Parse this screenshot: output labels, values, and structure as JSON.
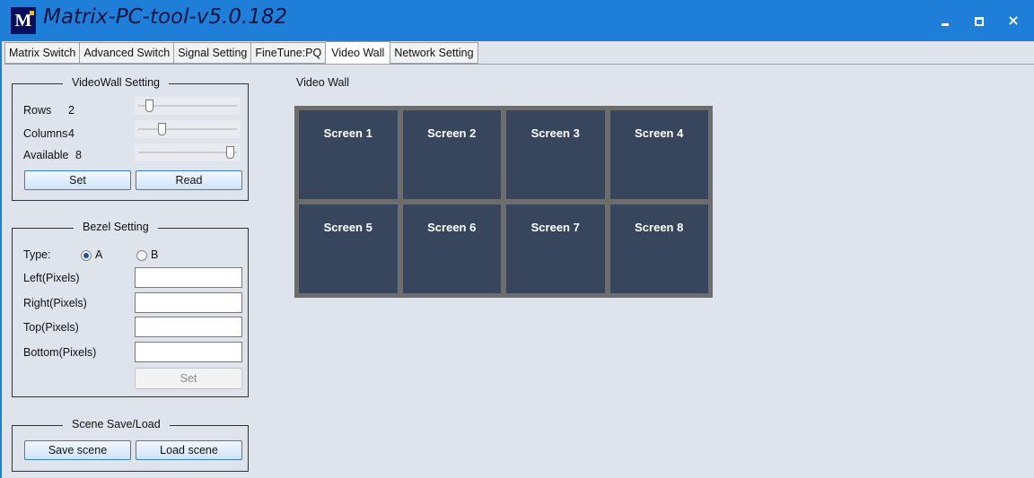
{
  "app": {
    "title": "Matrix-PC-tool-v5.0.182",
    "logo_text": "M",
    "window_controls": [
      "minimize-icon",
      "maximize-icon",
      "close-icon"
    ],
    "close_glyph": "×"
  },
  "tabs": [
    {
      "label": "Matrix Switch",
      "active": false
    },
    {
      "label": "Advanced Switch",
      "active": false
    },
    {
      "label": "Signal Setting",
      "active": false
    },
    {
      "label": "FineTune:PQ",
      "active": false
    },
    {
      "label": "Video Wall",
      "active": true
    },
    {
      "label": "Network Setting",
      "active": false
    }
  ],
  "videowall_setting": {
    "legend": "VideoWall Setting",
    "rows_label": "Rows",
    "rows_value": "2",
    "columns_label": "Columns",
    "columns_value": "4",
    "available_label": "Available",
    "available_value": "8",
    "set_label": "Set",
    "read_label": "Read"
  },
  "bezel_setting": {
    "legend": "Bezel Setting",
    "type_label": "Type:",
    "option_a": "A",
    "option_b": "B",
    "selected": "A",
    "left_label": "Left(Pixels)",
    "right_label": "Right(Pixels)",
    "top_label": "Top(Pixels)",
    "bottom_label": "Bottom(Pixels)",
    "left_value": "",
    "right_value": "",
    "top_value": "",
    "bottom_value": "",
    "set_label": "Set"
  },
  "scene": {
    "legend": "Scene Save/Load",
    "save_label": "Save scene",
    "load_label": "Load scene"
  },
  "video_wall": {
    "title": "Video Wall",
    "rows": 2,
    "columns": 4,
    "screens": [
      "Screen 1",
      "Screen 2",
      "Screen 3",
      "Screen 4",
      "Screen 5",
      "Screen 6",
      "Screen 7",
      "Screen 8"
    ]
  },
  "colors": {
    "titlebar": "#1f7fd8",
    "background": "#dfe3ec",
    "screen_tile": "#37465d",
    "wall_frame": "#6d6d6d",
    "button_border": "#3c7fc0"
  }
}
